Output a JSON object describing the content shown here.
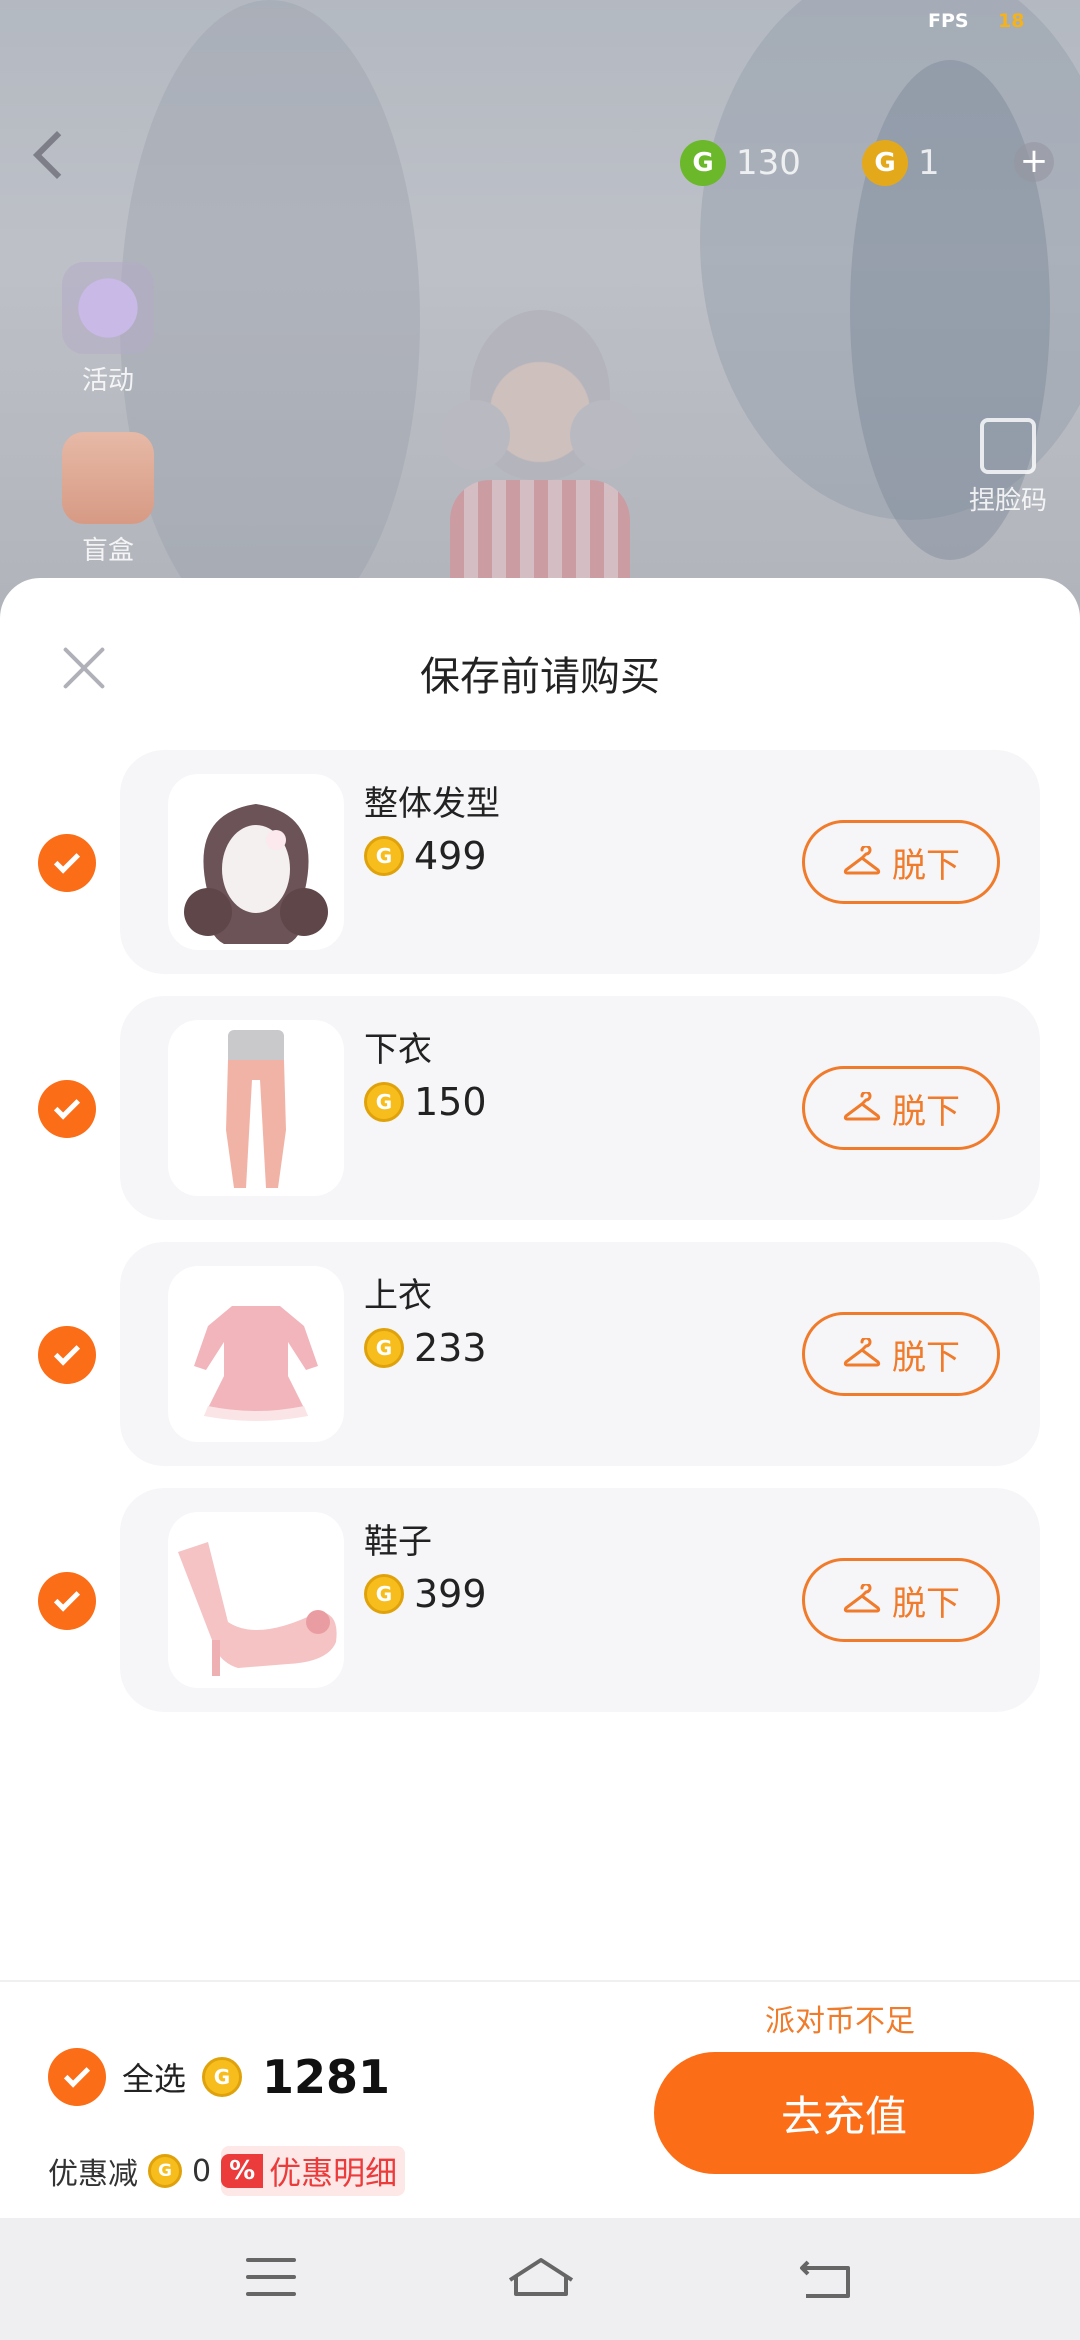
{
  "status": {
    "fps_label": "FPS",
    "fps_value": "18"
  },
  "top_bar": {
    "currency_green": "130",
    "currency_gold": "1",
    "colors": {
      "green": "#6bb82a",
      "gold": "#e4a91b"
    }
  },
  "side_menu": {
    "events_label": "活动",
    "blindbox_label": "盲盒",
    "face_code_label": "捏脸码"
  },
  "sheet": {
    "title": "保存前请购买",
    "items": [
      {
        "name": "整体发型",
        "price": "499",
        "action": "脱下"
      },
      {
        "name": "下衣",
        "price": "150",
        "action": "脱下"
      },
      {
        "name": "上衣",
        "price": "233",
        "action": "脱下"
      },
      {
        "name": "鞋子",
        "price": "399",
        "action": "脱下"
      }
    ]
  },
  "footer": {
    "warning": "派对币不足",
    "select_all": "全选",
    "total": "1281",
    "discount_label": "优惠减",
    "discount_value": "0",
    "discount_badge": "%",
    "discount_detail": "优惠明细",
    "recharge_button": "去充值"
  },
  "colors": {
    "accent": "#fb6d17",
    "outline": "#f07b2b",
    "discount": "#ec3b3b"
  }
}
